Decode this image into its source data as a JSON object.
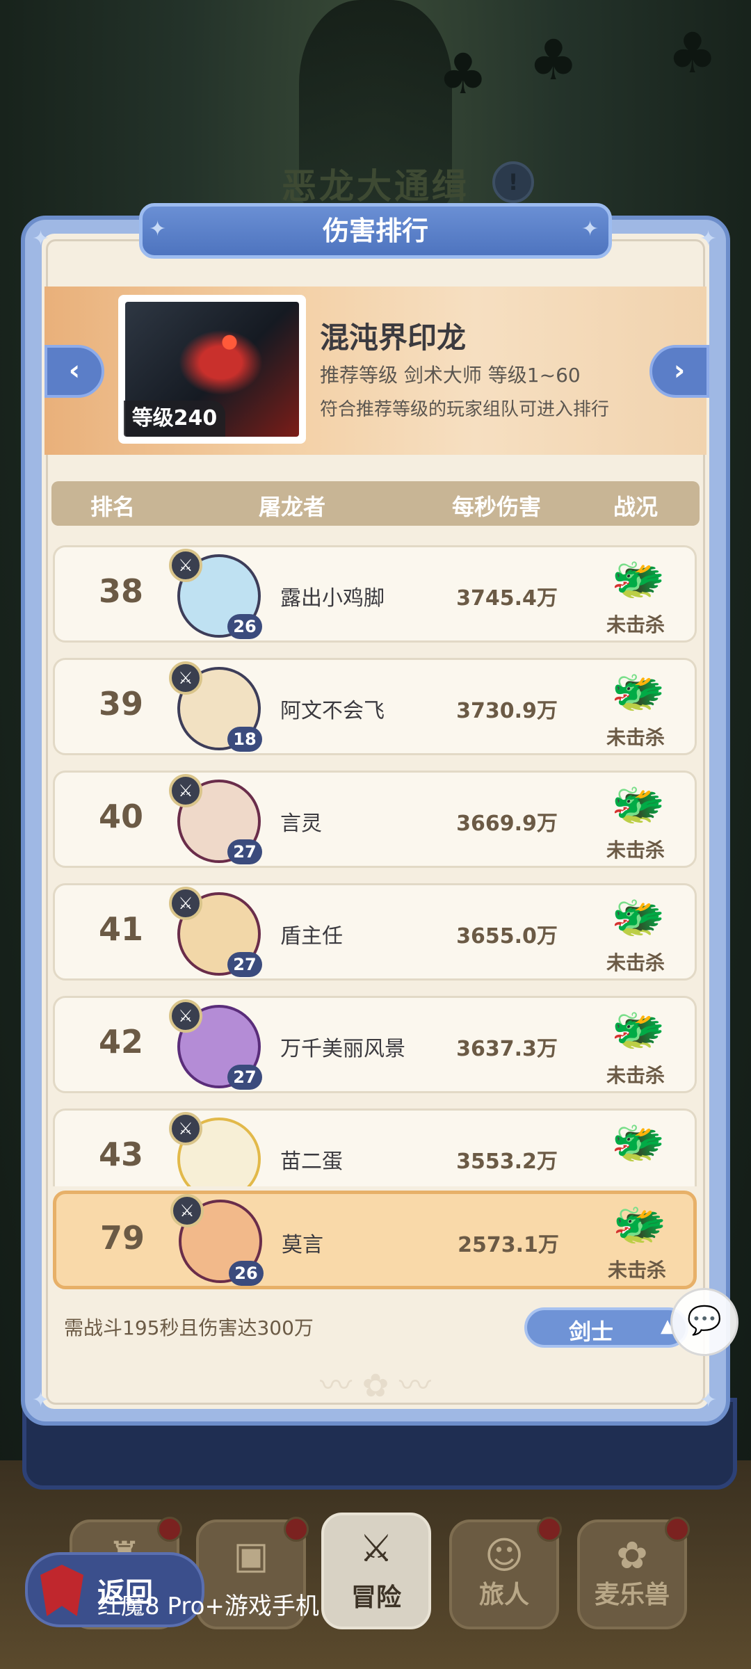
{
  "screen": {
    "title": "恶龙大通缉",
    "help_icon": "!"
  },
  "panel": {
    "title": "伤害排行"
  },
  "boss": {
    "name": "混沌界印龙",
    "level_badge": "等级240",
    "recommend": "推荐等级 剑术大师 等级1~60",
    "rule": "符合推荐等级的玩家组队可进入排行",
    "prev_glyph": "‹",
    "next_glyph": "›"
  },
  "table": {
    "headers": [
      "排名",
      "屠龙者",
      "每秒伤害",
      "战况"
    ],
    "rows": [
      {
        "rank": "38",
        "name": "露出小鸡脚",
        "level": "26",
        "damage": "3745.4万",
        "status": "未击杀",
        "avatar_color": "#bfe1f2"
      },
      {
        "rank": "39",
        "name": "阿文不会飞",
        "level": "18",
        "damage": "3730.9万",
        "status": "未击杀",
        "avatar_color": "#f2e1c2"
      },
      {
        "rank": "40",
        "name": "言灵",
        "level": "27",
        "damage": "3669.9万",
        "status": "未击杀",
        "avatar_color": "#efd9c9"
      },
      {
        "rank": "41",
        "name": "盾主任",
        "level": "27",
        "damage": "3655.0万",
        "status": "未击杀",
        "avatar_color": "#f2d7a8"
      },
      {
        "rank": "42",
        "name": "万千美丽风景",
        "level": "27",
        "damage": "3637.3万",
        "status": "未击杀",
        "avatar_color": "#b48cd6"
      },
      {
        "rank": "43",
        "name": "苗二蛋",
        "level": "",
        "damage": "3553.2万",
        "status": "",
        "avatar_color": "#f7efd6"
      }
    ]
  },
  "my_rank": {
    "rank": "79",
    "name": "莫言",
    "level": "26",
    "damage": "2573.1万",
    "status": "未击杀",
    "avatar_color": "#f2b98a"
  },
  "footer": {
    "requirement": "需战斗195秒且伤害达300万",
    "class_button": "剑士",
    "class_caret": "▲"
  },
  "bottom_nav": {
    "items": [
      {
        "label": "",
        "glyph": "♜"
      },
      {
        "label": "",
        "glyph": "▣"
      },
      {
        "label": "冒险",
        "glyph": "⚔"
      },
      {
        "label": "旅人",
        "glyph": "☺"
      },
      {
        "label": "麦乐兽",
        "glyph": "✿"
      }
    ],
    "back": "返回"
  },
  "overlay": {
    "watermark": "红魔8 Pro+游戏手机"
  },
  "icons": {
    "weapon": "⚔",
    "dragon": "🐲",
    "chat": "💬"
  }
}
